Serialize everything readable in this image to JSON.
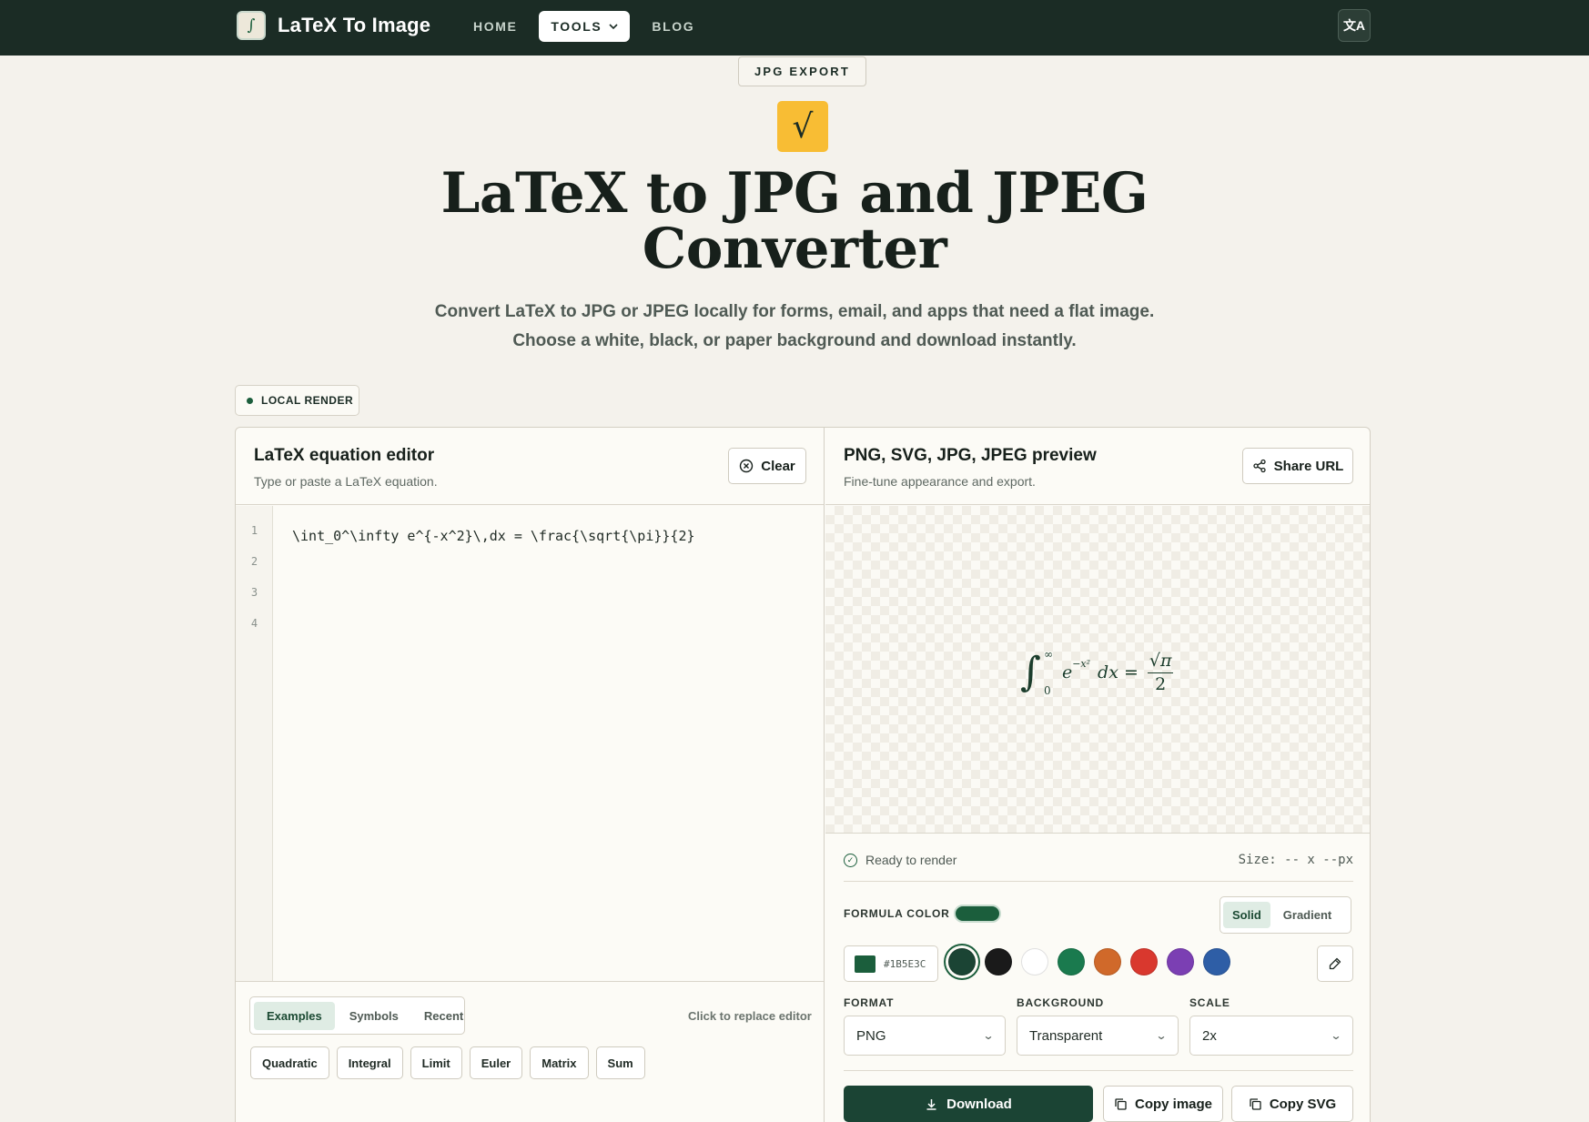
{
  "app": {
    "name": "LaTeX To Image",
    "logo_icon": "latex-logo-icon"
  },
  "nav": {
    "home": "HOME",
    "tools": "TOOLS",
    "blog": "BLOG",
    "language_icon": "translate-icon"
  },
  "hero": {
    "tag": "JPG EXPORT",
    "icon_glyph": "√",
    "title_line1": "LaTeX to JPG and JPEG",
    "title_line2": "Converter",
    "subtitle_line1": "Convert LaTeX to JPG or JPEG locally for forms, email, and apps that need a flat image.",
    "subtitle_line2": "Choose a white, black, or paper background and download instantly."
  },
  "local_badge": "LOCAL RENDER",
  "editor": {
    "title": "LaTeX equation editor",
    "description": "Type or paste a LaTeX equation.",
    "clear_label": "Clear",
    "line_numbers": [
      "1",
      "2",
      "3",
      "4"
    ],
    "code": "\\int_0^\\infty e^{-x^2}\\,dx = \\frac{\\sqrt{\\pi}}{2}",
    "tabs": [
      "Examples",
      "Symbols",
      "Recent"
    ],
    "active_tab": "Examples",
    "replace_hint": "Click to replace editor",
    "examples": [
      "Quadratic",
      "Integral",
      "Limit",
      "Euler",
      "Matrix",
      "Sum"
    ]
  },
  "preview": {
    "title": "PNG, SVG, JPG, JPEG preview",
    "description": "Fine-tune appearance and export.",
    "share_label": "Share URL",
    "formula": {
      "upper": "∞",
      "lower": "0",
      "base": "e",
      "exponent": "−x²",
      "differential": "dx =",
      "numerator": "√π",
      "denominator": "2"
    },
    "status": "Ready to render",
    "size": "Size: -- x --px",
    "formula_color_label": "FORMULA COLOR",
    "color_mode": {
      "solid": "Solid",
      "gradient": "Gradient",
      "active": "Solid"
    },
    "hex_value": "#1B5E3C",
    "swatch_colors": [
      "#1b4434",
      "#1a1a1a",
      "#ffffff",
      "#1a7a4e",
      "#d0692a",
      "#d9382e",
      "#7b3fb3",
      "#2e5ea6"
    ],
    "selected_swatch": "#1b4434",
    "format_label": "FORMAT",
    "format_value": "PNG",
    "background_label": "BACKGROUND",
    "background_value": "Transparent",
    "scale_label": "SCALE",
    "scale_value": "2x",
    "download_label": "Download",
    "copy_image_label": "Copy image",
    "copy_svg_label": "Copy SVG"
  },
  "colors": {
    "nav_bg": "#1b2c25",
    "accent": "#1b5e3c",
    "hero_icon": "#f8bd34",
    "page_bg": "#f4f2ec"
  }
}
